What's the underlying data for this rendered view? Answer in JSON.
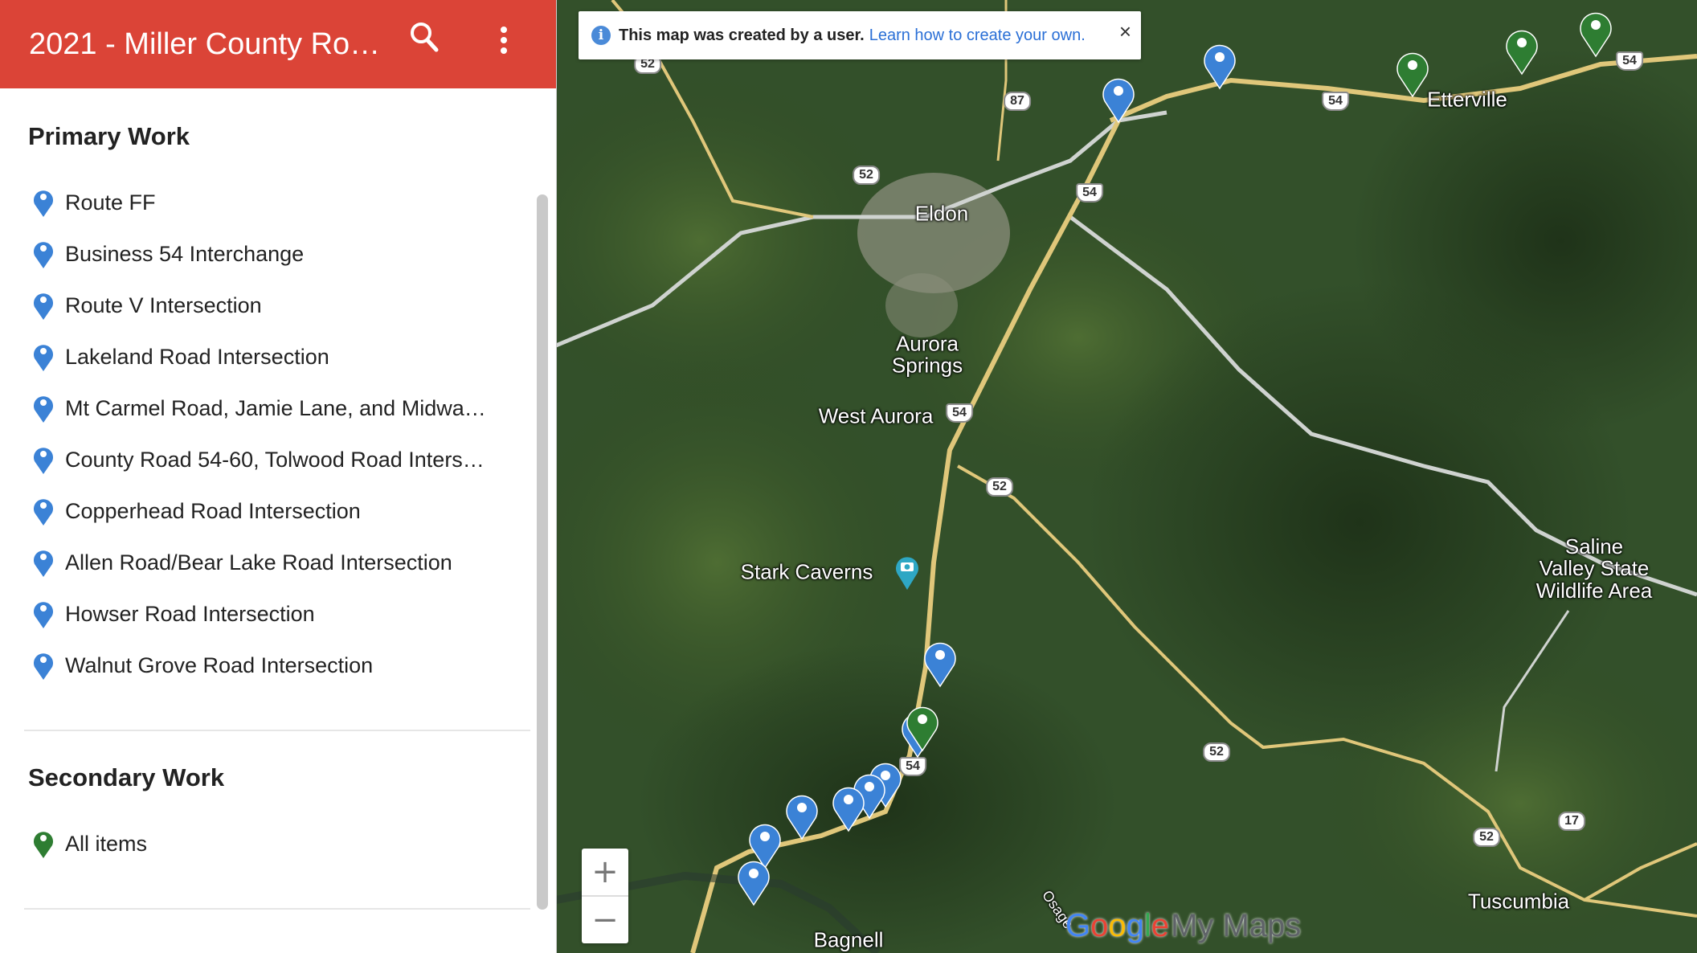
{
  "header": {
    "title": "2021 - Miller County Ro…",
    "search_icon": "search-icon",
    "menu_icon": "more-vert-icon",
    "color": "#db4437"
  },
  "sidebar": {
    "sections": [
      {
        "title": "Primary Work",
        "pin_color": "#3b82d6",
        "items": [
          "Route FF",
          "Business 54 Interchange",
          "Route V Intersection",
          "Lakeland Road Intersection",
          "Mt Carmel Road, Jamie Lane, and Midwa…",
          "County Road 54-60, Tolwood Road Inters…",
          "Copperhead Road Intersection",
          "Allen Road/Bear Lake Road Intersection",
          "Howser Road Intersection",
          "Walnut Grove Road Intersection"
        ]
      },
      {
        "title": "Secondary Work",
        "pin_color": "#2e7d32",
        "items": [
          "All items"
        ]
      }
    ]
  },
  "banner": {
    "text": "This map was created by a user.",
    "link": "Learn how to create your own.",
    "close": "×"
  },
  "map": {
    "places": [
      "Eldon",
      "Aurora\nSprings",
      "West Aurora",
      "Stark Caverns",
      "Etterville",
      "Saline\nValley State\nWildlife Area",
      "Tuscumbia",
      "Bagnell",
      "Osage"
    ],
    "route_shields": [
      "52",
      "87",
      "52",
      "54",
      "54",
      "54",
      "54",
      "52",
      "54",
      "52",
      "52",
      "17"
    ],
    "zoom_in": "+",
    "zoom_out": "−",
    "logo": {
      "g1": "G",
      "g2": "o",
      "g3": "o",
      "g4": "g",
      "g5": "l",
      "g6": "e",
      "mm": "My Maps"
    }
  }
}
